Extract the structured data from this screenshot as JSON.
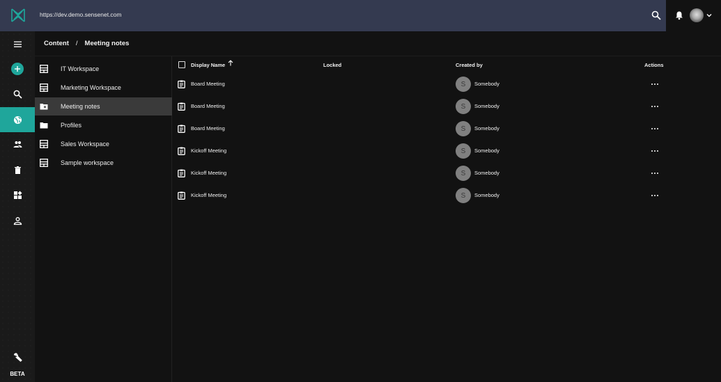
{
  "header": {
    "url": "https://dev.demo.sensenet.com",
    "logo_icon": "sensenet-logo",
    "search_icon": "search-icon",
    "notifications_icon": "bell-icon",
    "user_avatar": "user-avatar",
    "menu_chevron_icon": "chevron-down-icon"
  },
  "rail": {
    "items": [
      {
        "name": "menu",
        "icon": "hamburger-icon"
      },
      {
        "name": "add",
        "icon": "plus-icon"
      },
      {
        "name": "search",
        "icon": "search-icon"
      },
      {
        "name": "content",
        "icon": "globe-icon",
        "active": true
      },
      {
        "name": "users-and-groups",
        "icon": "people-icon"
      },
      {
        "name": "trash",
        "icon": "trash-icon"
      },
      {
        "name": "content-types",
        "icon": "widgets-icon"
      },
      {
        "name": "profile",
        "icon": "person-icon"
      },
      {
        "name": "settings",
        "icon": "wrench-icon"
      }
    ],
    "beta_label": "BETA"
  },
  "breadcrumb": {
    "items": [
      "Content",
      "Meeting notes"
    ],
    "separator": "/"
  },
  "tree": {
    "items": [
      {
        "label": "IT Workspace",
        "icon": "workspace-icon"
      },
      {
        "label": "Marketing Workspace",
        "icon": "workspace-icon"
      },
      {
        "label": "Meeting notes",
        "icon": "special-folder-icon",
        "active": true
      },
      {
        "label": "Profiles",
        "icon": "folder-icon"
      },
      {
        "label": "Sales Workspace",
        "icon": "workspace-icon"
      },
      {
        "label": "Sample workspace",
        "icon": "workspace-icon"
      }
    ]
  },
  "grid": {
    "columns": {
      "display_name": "Display Name",
      "locked": "Locked",
      "created_by": "Created by",
      "actions": "Actions"
    },
    "sort": {
      "column": "Display Name",
      "direction": "ascending"
    },
    "rows": [
      {
        "name": "Board Meeting",
        "locked": "",
        "creator_initial": "S",
        "creator": "Somebody"
      },
      {
        "name": "Board Meeting",
        "locked": "",
        "creator_initial": "S",
        "creator": "Somebody"
      },
      {
        "name": "Board Meeting",
        "locked": "",
        "creator_initial": "S",
        "creator": "Somebody"
      },
      {
        "name": "Kickoff Meeting",
        "locked": "",
        "creator_initial": "S",
        "creator": "Somebody"
      },
      {
        "name": "Kickoff Meeting",
        "locked": "",
        "creator_initial": "S",
        "creator": "Somebody"
      },
      {
        "name": "Kickoff Meeting",
        "locked": "",
        "creator_initial": "S",
        "creator": "Somebody"
      }
    ]
  },
  "colors": {
    "accent": "#1fa69b",
    "header_bg": "#343a50",
    "background": "#121212",
    "selected_row": "#3a3a3a"
  }
}
